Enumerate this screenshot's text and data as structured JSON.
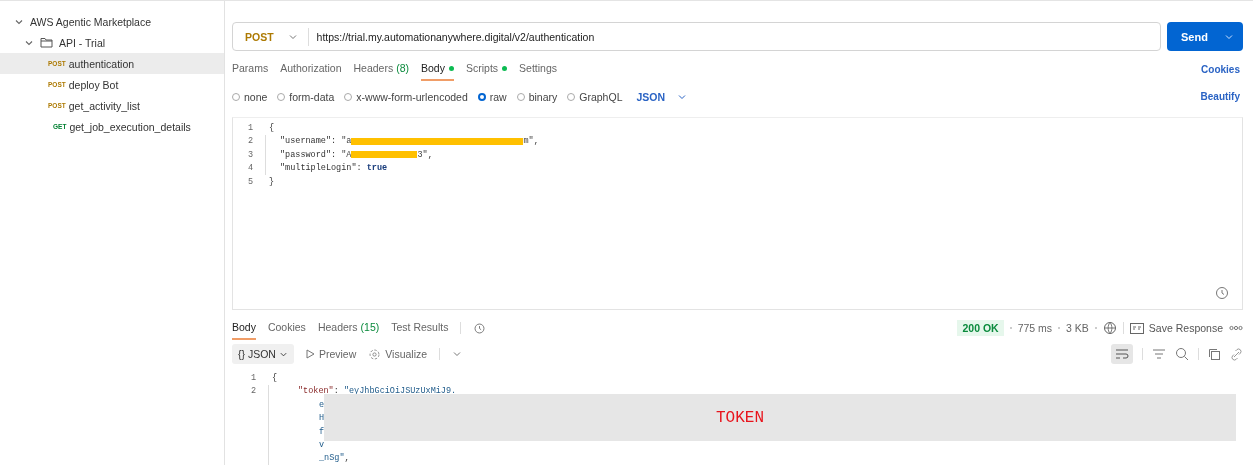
{
  "sidebar": {
    "collection": {
      "name": "AWS Agentic Marketplace",
      "expanded": true
    },
    "folder": {
      "name": "API - Trial",
      "expanded": true
    },
    "requests": [
      {
        "method": "POST",
        "name": "authentication",
        "selected": true
      },
      {
        "method": "POST",
        "name": "deploy Bot",
        "selected": false
      },
      {
        "method": "POST",
        "name": "get_activity_list",
        "selected": false
      },
      {
        "method": "GET",
        "name": "get_job_execution_details",
        "selected": false
      }
    ]
  },
  "request": {
    "method": "POST",
    "url": "https://trial.my.automationanywhere.digital/v2/authentication",
    "send": "Send"
  },
  "request_tabs": [
    {
      "label": "Params",
      "selected": false
    },
    {
      "label": "Authorization",
      "selected": false
    },
    {
      "label": "Headers",
      "count": "(8)",
      "selected": false
    },
    {
      "label": "Body",
      "dot": true,
      "selected": true
    },
    {
      "label": "Scripts",
      "dot": true,
      "selected": false
    },
    {
      "label": "Settings",
      "selected": false
    }
  ],
  "cookies": "Cookies",
  "body_modes": [
    {
      "label": "none",
      "selected": false
    },
    {
      "label": "form-data",
      "selected": false
    },
    {
      "label": "x-www-form-urlencoded",
      "selected": false
    },
    {
      "label": "raw",
      "selected": true
    },
    {
      "label": "binary",
      "selected": false
    },
    {
      "label": "GraphQL",
      "selected": false
    }
  ],
  "format": "JSON",
  "beautify": "Beautify",
  "body_lines": [
    {
      "number": "1",
      "parts": [
        {
          "kind": "punct",
          "text": "{"
        }
      ]
    },
    {
      "number": "2",
      "parts": [
        {
          "kind": "key",
          "text": "\"username\""
        },
        {
          "kind": "punct",
          "text": ": "
        },
        {
          "kind": "string",
          "text": "\"a"
        },
        {
          "kind": "redacted"
        },
        {
          "kind": "string",
          "text": "m\""
        },
        {
          "kind": "punct",
          "text": ","
        }
      ]
    },
    {
      "number": "3",
      "parts": [
        {
          "kind": "key",
          "text": "\"password\""
        },
        {
          "kind": "punct",
          "text": ": "
        },
        {
          "kind": "string",
          "text": "\"A"
        },
        {
          "kind": "redacted"
        },
        {
          "kind": "string",
          "text": "3\""
        },
        {
          "kind": "punct",
          "text": ","
        }
      ]
    },
    {
      "number": "4",
      "parts": [
        {
          "kind": "key",
          "text": "\"multipleLogin\""
        },
        {
          "kind": "punct",
          "text": ": "
        },
        {
          "kind": "bool",
          "text": "true"
        }
      ]
    },
    {
      "number": "5",
      "parts": [
        {
          "kind": "punct",
          "text": "}"
        }
      ]
    }
  ],
  "response": {
    "tabs": [
      {
        "label": "Body",
        "selected": true
      },
      {
        "label": "Cookies",
        "selected": false
      },
      {
        "label": "Headers",
        "count": "(15)",
        "selected": false
      },
      {
        "label": "Test Results",
        "selected": false
      }
    ],
    "status": "200 OK",
    "time": "775 ms",
    "size": "3 KB",
    "save": "Save Response",
    "view": {
      "format": "{} JSON",
      "preview": "Preview",
      "visualize": "Visualize"
    },
    "lines": [
      {
        "number": "1",
        "parts": [
          {
            "kind": "punct",
            "text": "{"
          }
        ]
      },
      {
        "number": "2",
        "parts": [
          {
            "kind": "key",
            "text": "\"token\""
          },
          {
            "kind": "punct",
            "text": ": "
          },
          {
            "kind": "string",
            "text": "\"eyJhbGciOiJSUzUxMiJ9."
          }
        ]
      },
      {
        "parts": [
          {
            "kind": "string",
            "text": "e"
          }
        ]
      },
      {
        "parts": [
          {
            "kind": "string",
            "text": "H"
          }
        ]
      },
      {
        "parts": [
          {
            "kind": "string",
            "text": "f"
          }
        ]
      },
      {
        "parts": [
          {
            "kind": "string",
            "text": "v"
          }
        ]
      },
      {
        "parts": [
          {
            "kind": "string",
            "text": "_nSg\""
          },
          {
            "kind": "punct",
            "text": ","
          }
        ]
      }
    ],
    "overlay": "TOKEN"
  }
}
